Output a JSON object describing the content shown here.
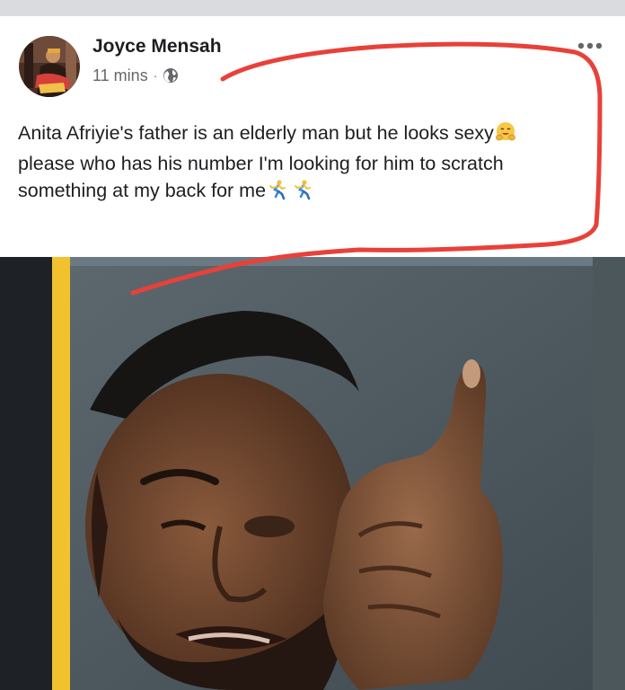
{
  "post": {
    "author_name": "Joyce Mensah",
    "timestamp": "11 mins",
    "separator": "·",
    "privacy_icon": "globe-icon",
    "more_icon": "more-horizontal-icon",
    "text_lines": [
      "Anita Afriyie's father is an elderly man but he looks sexy",
      "please who has his number I'm looking for him to scratch",
      "something at my back for me"
    ],
    "emojis": [
      "hugging-face-icon",
      "running-man-icon",
      "running-man-icon"
    ]
  },
  "colors": {
    "annotation_stroke": "#e8413a",
    "frame_accent": "#f2c12e",
    "name_text": "#1c1e21",
    "meta_text": "#65676b"
  }
}
